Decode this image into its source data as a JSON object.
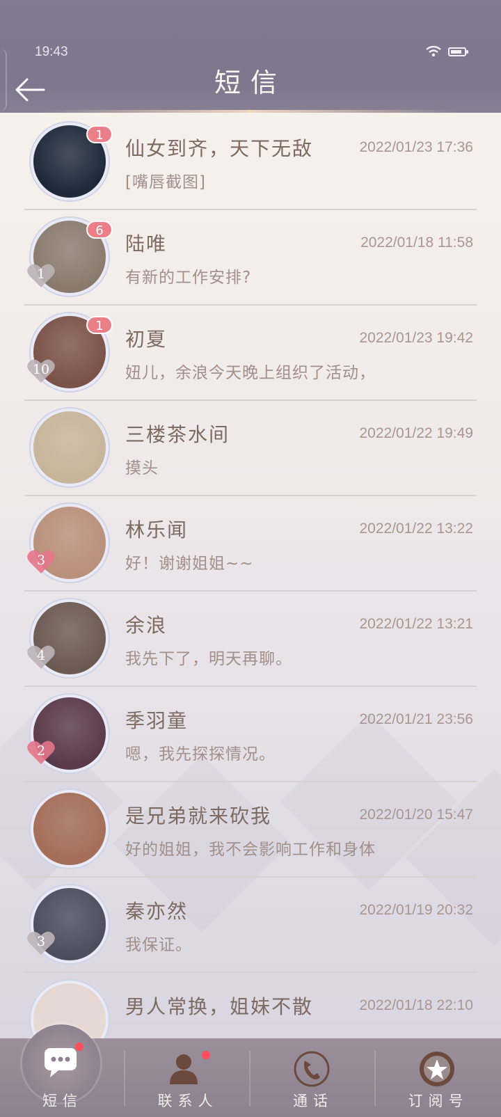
{
  "status": {
    "time": "19:43"
  },
  "header": {
    "title": "短信"
  },
  "messages": [
    {
      "name": "仙女到齐，天下无敌",
      "time": "2022/01/23 17:36",
      "preview": "[嘴唇截图]",
      "badge": "1",
      "level": "",
      "avatar_color": "#1d2838",
      "heart_color": ""
    },
    {
      "name": "陆唯",
      "time": "2022/01/18 11:58",
      "preview": "有新的工作安排?",
      "badge": "6",
      "level": "1",
      "avatar_color": "#8a7a6e",
      "heart_color": "#bdb4b8"
    },
    {
      "name": "初夏",
      "time": "2022/01/23 19:42",
      "preview": "妞儿，余浪今天晚上组织了活动，",
      "badge": "1",
      "level": "10",
      "avatar_color": "#7a5248",
      "heart_color": "#bdb4b8"
    },
    {
      "name": "三楼茶水间",
      "time": "2022/01/22 19:49",
      "preview": "摸头",
      "badge": "",
      "level": "",
      "avatar_color": "#c7b59a",
      "heart_color": ""
    },
    {
      "name": "林乐闻",
      "time": "2022/01/22 13:22",
      "preview": "好！谢谢姐姐~~",
      "badge": "",
      "level": "3",
      "avatar_color": "#b9907a",
      "heart_color": "#e6758a"
    },
    {
      "name": "余浪",
      "time": "2022/01/22 13:21",
      "preview": "我先下了，明天再聊。",
      "badge": "",
      "level": "4",
      "avatar_color": "#6b5a52",
      "heart_color": "#bdb4b8"
    },
    {
      "name": "季羽童",
      "time": "2022/01/21 23:56",
      "preview": "嗯，我先探探情况。",
      "badge": "",
      "level": "2",
      "avatar_color": "#5a3a4a",
      "heart_color": "#e6758a"
    },
    {
      "name": "是兄弟就来砍我",
      "time": "2022/01/20 15:47",
      "preview": "好的姐姐，我不会影响工作和身体",
      "badge": "",
      "level": "",
      "avatar_color": "#a46e58",
      "heart_color": ""
    },
    {
      "name": "秦亦然",
      "time": "2022/01/19 20:32",
      "preview": "我保证。",
      "badge": "",
      "level": "3",
      "avatar_color": "#4c4e5e",
      "heart_color": "#bdb4b8"
    },
    {
      "name": "男人常换，姐妹不散",
      "time": "2022/01/18 22:10",
      "preview": "",
      "badge": "",
      "level": "",
      "avatar_color": "#e6d8d2",
      "heart_color": ""
    }
  ],
  "nav": [
    {
      "label": "短信",
      "icon": "chat-bubble-icon",
      "active": true,
      "dot": true
    },
    {
      "label": "联系人",
      "icon": "person-icon",
      "active": false,
      "dot": true
    },
    {
      "label": "通话",
      "icon": "phone-icon",
      "active": false,
      "dot": false
    },
    {
      "label": "订阅号",
      "icon": "star-badge-icon",
      "active": false,
      "dot": false
    }
  ],
  "colors": {
    "accent_red": "#ea7f8a",
    "text_name": "#7d6a61",
    "text_meta": "#a99690"
  }
}
